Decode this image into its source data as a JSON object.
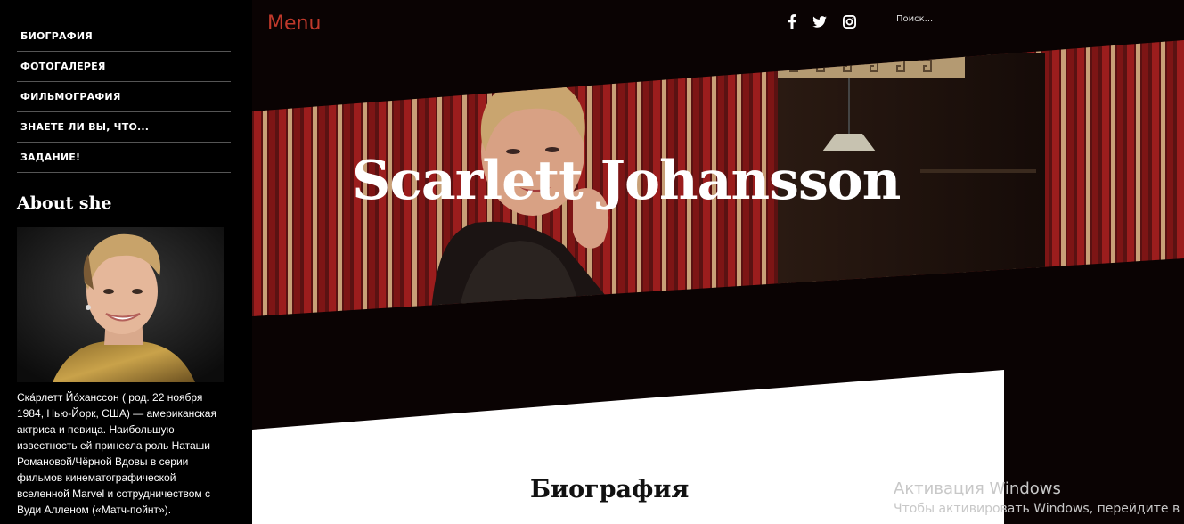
{
  "sidebar": {
    "nav": [
      {
        "label": "БИОГРАФИЯ"
      },
      {
        "label": "ФОТОГАЛЕРЕЯ"
      },
      {
        "label": "ФИЛЬМОГРАФИЯ"
      },
      {
        "label": "ЗНАЕТЕ ЛИ ВЫ, ЧТО..."
      },
      {
        "label": "ЗАДАНИЕ!"
      }
    ],
    "about_title": "About she",
    "about_text": "Ска́рлетт Йо́ханссон ( род. 22 ноября 1984, Нью-Йорк, США) — американская актриса и певица. Наибольшую известность ей принесла роль Наташи Романовой/Чёрной Вдовы в серии фильмов кинематографической вселенной Marvel и сотрудничеством с Вуди Алленом («Матч-пойнт»)."
  },
  "header": {
    "menu_label": "Menu",
    "social": [
      "facebook-icon",
      "twitter-icon",
      "instagram-icon"
    ],
    "search_placeholder": "Поиск..."
  },
  "hero": {
    "title": "Scarlett Johansson"
  },
  "content": {
    "section_title": "Биография"
  },
  "overlay": {
    "activation_title": "Активация Windows",
    "activation_sub": "Чтобы активировать Windows, перейдите в"
  },
  "colors": {
    "accent": "#c0392b",
    "background": "#0a0303",
    "curtain_red": "#8b1a1a"
  }
}
